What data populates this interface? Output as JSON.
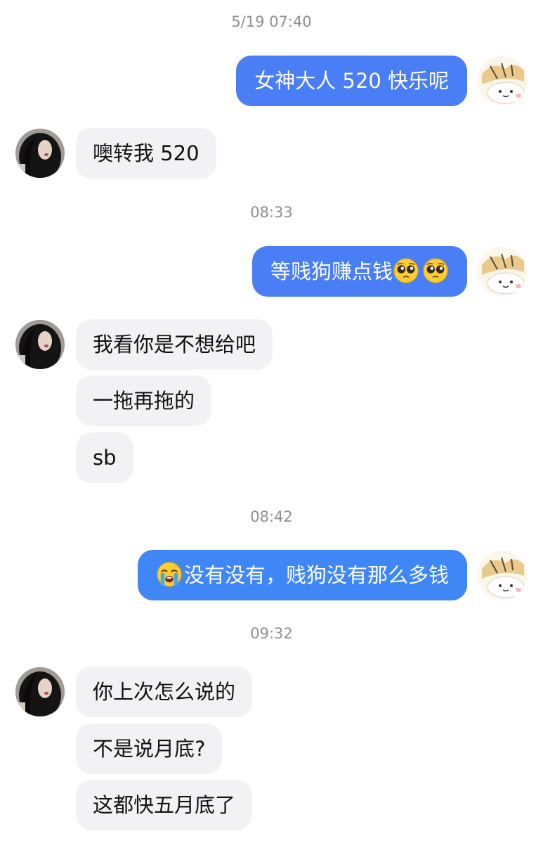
{
  "chat": {
    "timestamps": {
      "t1": "5/19 07:40",
      "t2": "08:33",
      "t3": "08:42",
      "t4": "09:32"
    },
    "messages": {
      "m1": "女神大人 520 快乐呢",
      "m2": "噢转我 520",
      "m3": "等贱狗赚点钱",
      "m4": "我看你是不想给吧",
      "m5": "一拖再拖的",
      "m6": "sb",
      "m7": "没有没有，贱狗没有那么多钱",
      "m8": "你上次怎么说的",
      "m9": "不是说月底?",
      "m10": "这都快五月底了"
    },
    "icons": {
      "pleading": "pleading-face-emoji",
      "crying": "loudly-crying-face-emoji",
      "self_avatar": "cartoon-cat-avatar",
      "other_avatar": "girl-photo-avatar"
    },
    "colors": {
      "outgoing_bubble": "#4a7ef6",
      "incoming_bubble": "#f2f2f5",
      "timestamp": "#8e8e93"
    }
  }
}
